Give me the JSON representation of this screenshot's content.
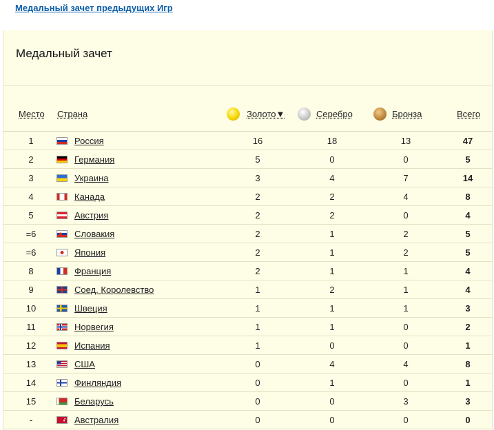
{
  "top_link": "Медальный зачет предыдущих Игр",
  "panel_title": "Медальный зачет",
  "headers": {
    "rank": "Место",
    "country": "Страна",
    "gold": "Золото▼",
    "silver": "Серебро",
    "bronze": "Бронза",
    "total": "Всего"
  },
  "rows": [
    {
      "rank": "1",
      "country": "Россия",
      "gold": "16",
      "silver": "18",
      "bronze": "13",
      "total": "47",
      "flag": "russia-flag-icon"
    },
    {
      "rank": "2",
      "country": "Германия",
      "gold": "5",
      "silver": "0",
      "bronze": "0",
      "total": "5",
      "flag": "germany-flag-icon"
    },
    {
      "rank": "3",
      "country": "Украина",
      "gold": "3",
      "silver": "4",
      "bronze": "7",
      "total": "14",
      "flag": "ukraine-flag-icon"
    },
    {
      "rank": "4",
      "country": "Канада",
      "gold": "2",
      "silver": "2",
      "bronze": "4",
      "total": "8",
      "flag": "canada-flag-icon"
    },
    {
      "rank": "5",
      "country": "Австрия",
      "gold": "2",
      "silver": "2",
      "bronze": "0",
      "total": "4",
      "flag": "austria-flag-icon"
    },
    {
      "rank": "=6",
      "country": "Словакия",
      "gold": "2",
      "silver": "1",
      "bronze": "2",
      "total": "5",
      "flag": "slovakia-flag-icon"
    },
    {
      "rank": "=6",
      "country": "Япония",
      "gold": "2",
      "silver": "1",
      "bronze": "2",
      "total": "5",
      "flag": "japan-flag-icon"
    },
    {
      "rank": "8",
      "country": "Франция",
      "gold": "2",
      "silver": "1",
      "bronze": "1",
      "total": "4",
      "flag": "france-flag-icon"
    },
    {
      "rank": "9",
      "country": "Соед. Королевство",
      "gold": "1",
      "silver": "2",
      "bronze": "1",
      "total": "4",
      "flag": "uk-flag-icon"
    },
    {
      "rank": "10",
      "country": "Швеция",
      "gold": "1",
      "silver": "1",
      "bronze": "1",
      "total": "3",
      "flag": "sweden-flag-icon"
    },
    {
      "rank": "11",
      "country": "Норвегия",
      "gold": "1",
      "silver": "1",
      "bronze": "0",
      "total": "2",
      "flag": "norway-flag-icon"
    },
    {
      "rank": "12",
      "country": "Испания",
      "gold": "1",
      "silver": "0",
      "bronze": "0",
      "total": "1",
      "flag": "spain-flag-icon"
    },
    {
      "rank": "13",
      "country": "США",
      "gold": "0",
      "silver": "4",
      "bronze": "4",
      "total": "8",
      "flag": "usa-flag-icon"
    },
    {
      "rank": "14",
      "country": "Финляндия",
      "gold": "0",
      "silver": "1",
      "bronze": "0",
      "total": "1",
      "flag": "finland-flag-icon"
    },
    {
      "rank": "15",
      "country": "Беларусь",
      "gold": "0",
      "silver": "0",
      "bronze": "3",
      "total": "3",
      "flag": "belarus-flag-icon"
    },
    {
      "rank": "-",
      "country": "Австралия",
      "gold": "0",
      "silver": "0",
      "bronze": "0",
      "total": "0",
      "flag": "australia-flag-icon"
    }
  ]
}
